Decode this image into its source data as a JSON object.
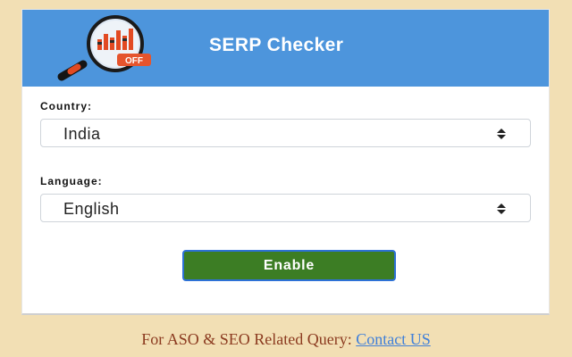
{
  "header": {
    "title": "SERP Checker",
    "logo_badge": "OFF",
    "brand_color": "#4d95dc"
  },
  "form": {
    "country": {
      "label": "Country:",
      "selected": "India"
    },
    "language": {
      "label": "Language:",
      "selected": "English"
    },
    "enable_label": "Enable"
  },
  "footer": {
    "text": "For ASO & SEO Related Query: ",
    "link_label": "Contact US"
  },
  "icons": {
    "logo": "magnifier-chart-icon",
    "select_arrow": "chevron-up-down-icon"
  },
  "colors": {
    "page_background": "#f2dfb4",
    "button": "#3c7d24",
    "footer_text": "#8b3a1f",
    "link": "#3f7fd9"
  }
}
